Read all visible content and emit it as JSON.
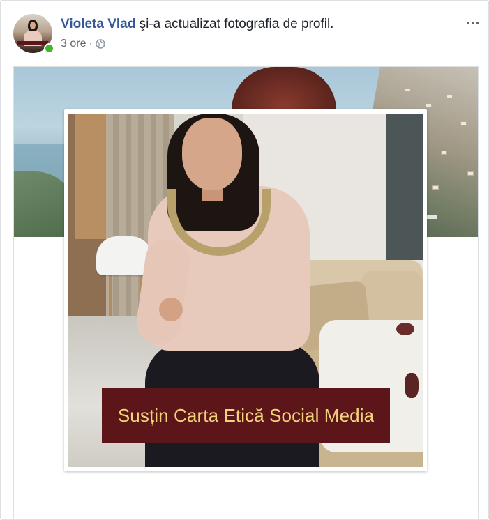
{
  "post": {
    "author": "Violeta Vlad",
    "action": " şi-a actualizat fotografia de profil.",
    "time": "3 ore",
    "separator": "·",
    "privacy_icon": "globe-icon",
    "more_icon": "more-options-icon",
    "online_status_color": "#42b72a",
    "author_color": "#365899"
  },
  "photo": {
    "caption": "Susțin Carta Etică Social Media",
    "caption_bg_color": "#5c1519",
    "caption_text_color": "#f2d37b"
  }
}
